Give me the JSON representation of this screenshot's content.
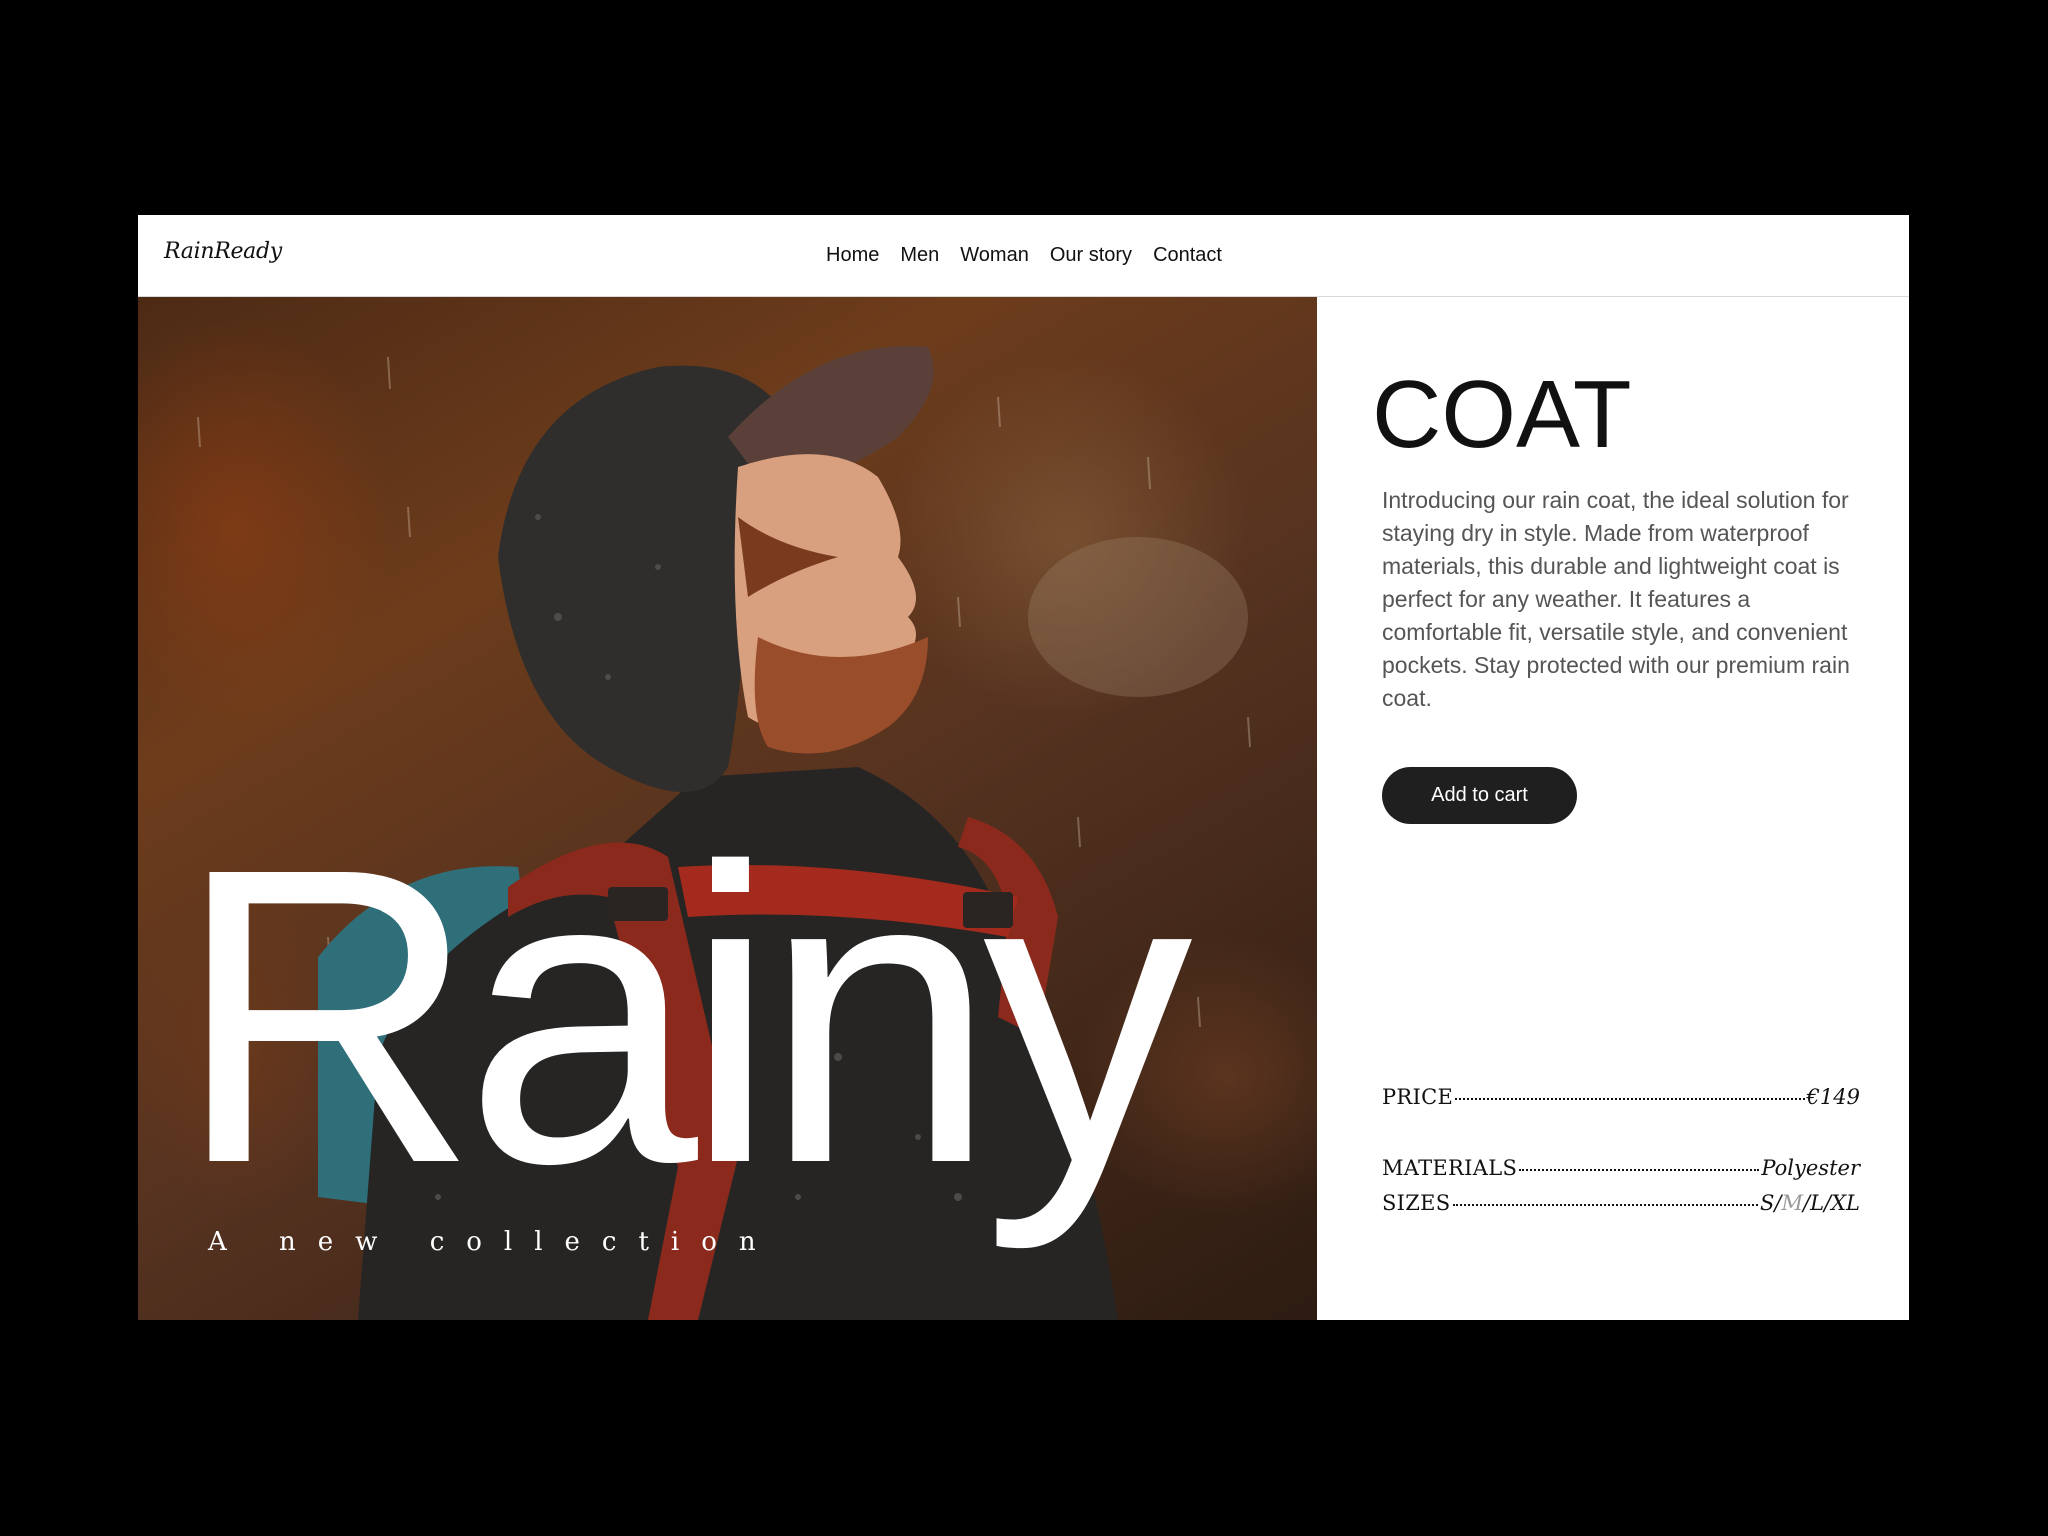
{
  "brand": {
    "logo": "RainReady"
  },
  "nav": {
    "items": [
      "Home",
      "Men",
      "Woman",
      "Our story",
      "Contact"
    ]
  },
  "hero": {
    "headline": "Rainy",
    "tagline": "A new collection"
  },
  "product": {
    "title": "COAT",
    "description": "Introducing our rain coat, the ideal solution for staying dry in style. Made from waterproof materials, this durable and lightweight coat is perfect for any weather. It features a comfortable fit, versatile style, and convenient pockets. Stay protected with our premium rain coat.",
    "cta_label": "Add to cart",
    "specs": {
      "price_label": "PRICE",
      "price_value": "€149",
      "materials_label": "MATERIALS",
      "materials_value": "Polyester",
      "sizes_label": "SIZES",
      "sizes": [
        "S",
        "M",
        "L",
        "XL"
      ],
      "size_separator": "/",
      "muted_size": "M"
    }
  },
  "colors": {
    "page_background": "#000000",
    "panel_background": "#ffffff",
    "button_background": "#1f1f1f",
    "headline_text": "#ffffff",
    "body_text": "#555555",
    "muted_size": "#9a9a9a"
  }
}
